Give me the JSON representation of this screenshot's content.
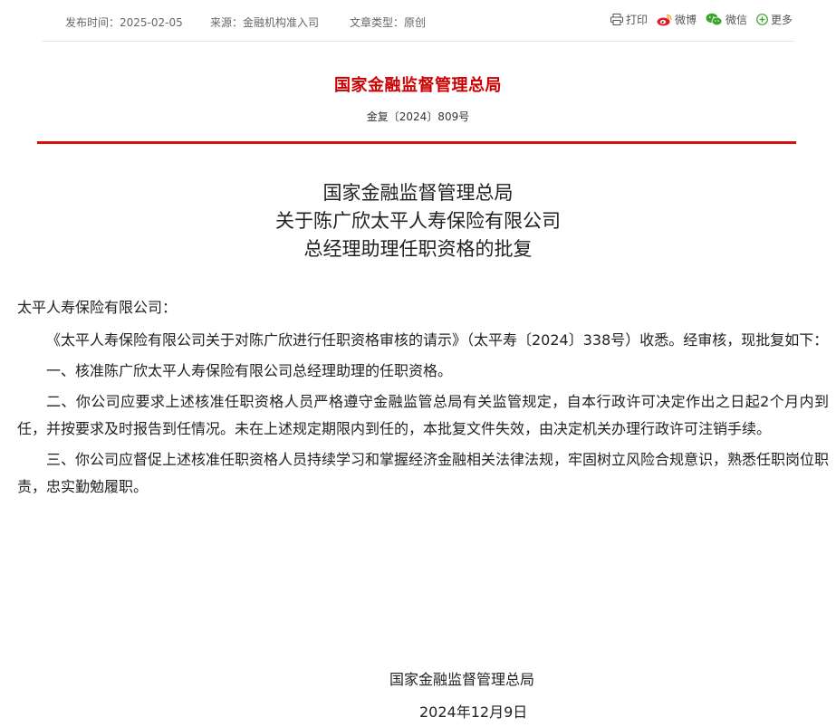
{
  "meta": {
    "date": "发布时间：2025-02-05",
    "source": "来源：金融机构准入司",
    "type": "文章类型：原创"
  },
  "share": {
    "print": "打印",
    "weibo": "微博",
    "wechat": "微信",
    "more": "更多"
  },
  "header": {
    "agency": "国家金融监督管理总局",
    "doc_number": "金复〔2024〕809号"
  },
  "title": {
    "line1": "国家金融监督管理总局",
    "line2": "关于陈广欣太平人寿保险有限公司",
    "line3": "总经理助理任职资格的批复"
  },
  "body": {
    "salutation": "太平人寿保险有限公司：",
    "paragraphs": [
      "《太平人寿保险有限公司关于对陈广欣进行任职资格审核的请示》（太平寿〔2024〕338号）收悉。经审核，现批复如下：",
      "一、核准陈广欣太平人寿保险有限公司总经理助理的任职资格。",
      "二、你公司应要求上述核准任职资格人员严格遵守金融监管总局有关监管规定，自本行政许可决定作出之日起2个月内到任，并按要求及时报告到任情况。未在上述规定期限内到任的，本批复文件失效，由决定机关办理行政许可注销手续。",
      "三、你公司应督促上述核准任职资格人员持续学习和掌握经济金融相关法律法规，牢固树立风险合规意识，熟悉任职岗位职责，忠实勤勉履职。"
    ]
  },
  "signature": {
    "org": "国家金融监督管理总局",
    "date": "2024年12月9日"
  },
  "colors": {
    "accent_red": "#cc0000",
    "rule_red": "#d8120f",
    "weibo": "#e6162d",
    "wechat": "#3aa52a",
    "more": "#3aa52a"
  },
  "icons": [
    "printer-icon",
    "weibo-icon",
    "wechat-icon",
    "plus-circle-icon"
  ]
}
